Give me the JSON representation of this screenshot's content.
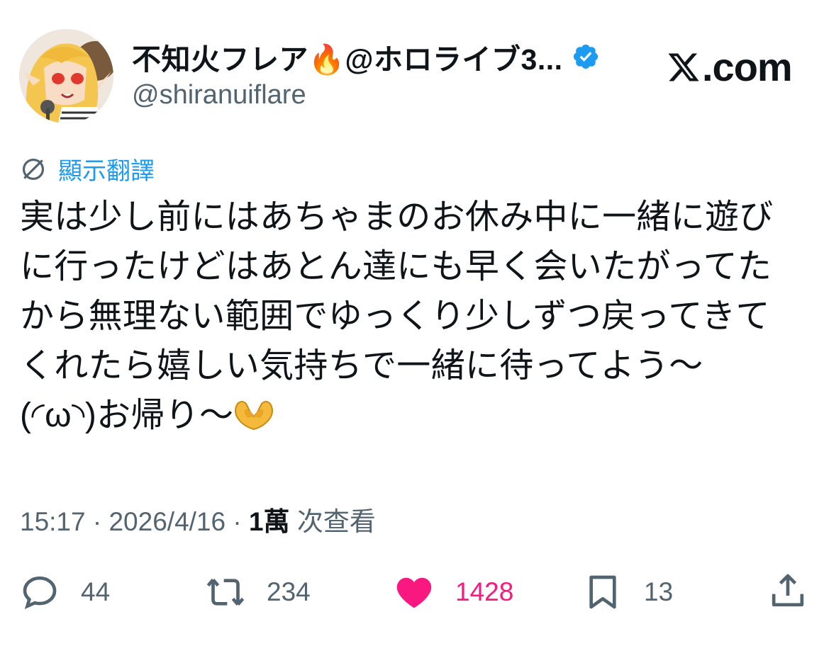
{
  "header": {
    "display_name": "不知火フレア🔥@ホロライブ3...",
    "handle": "@shiranuiflare",
    "site_label": ".com"
  },
  "translate": {
    "label": "顯示翻譯"
  },
  "tweet": {
    "lines": [
      "実は少し前にはあちゃまのお休み中に一緒に遊び",
      "に行ったけどはあとん達にも早く会いたがってた",
      "から無理ない範囲でゆっくり少しずつ戻ってきて",
      "くれたら嬉しい気持ちで一緒に待ってよう～",
      "(◜ω◝)お帰り～"
    ]
  },
  "meta": {
    "time": "15:17",
    "separator": " · ",
    "date": "2026/4/16",
    "views_count": "1萬",
    "views_label": " 次查看"
  },
  "actions": {
    "replies": "44",
    "reposts": "234",
    "likes": "1428",
    "bookmarks": "13"
  },
  "colors": {
    "accent": "#1d9bf0",
    "like": "#f91880",
    "muted": "#536471",
    "text": "#0f1419"
  }
}
